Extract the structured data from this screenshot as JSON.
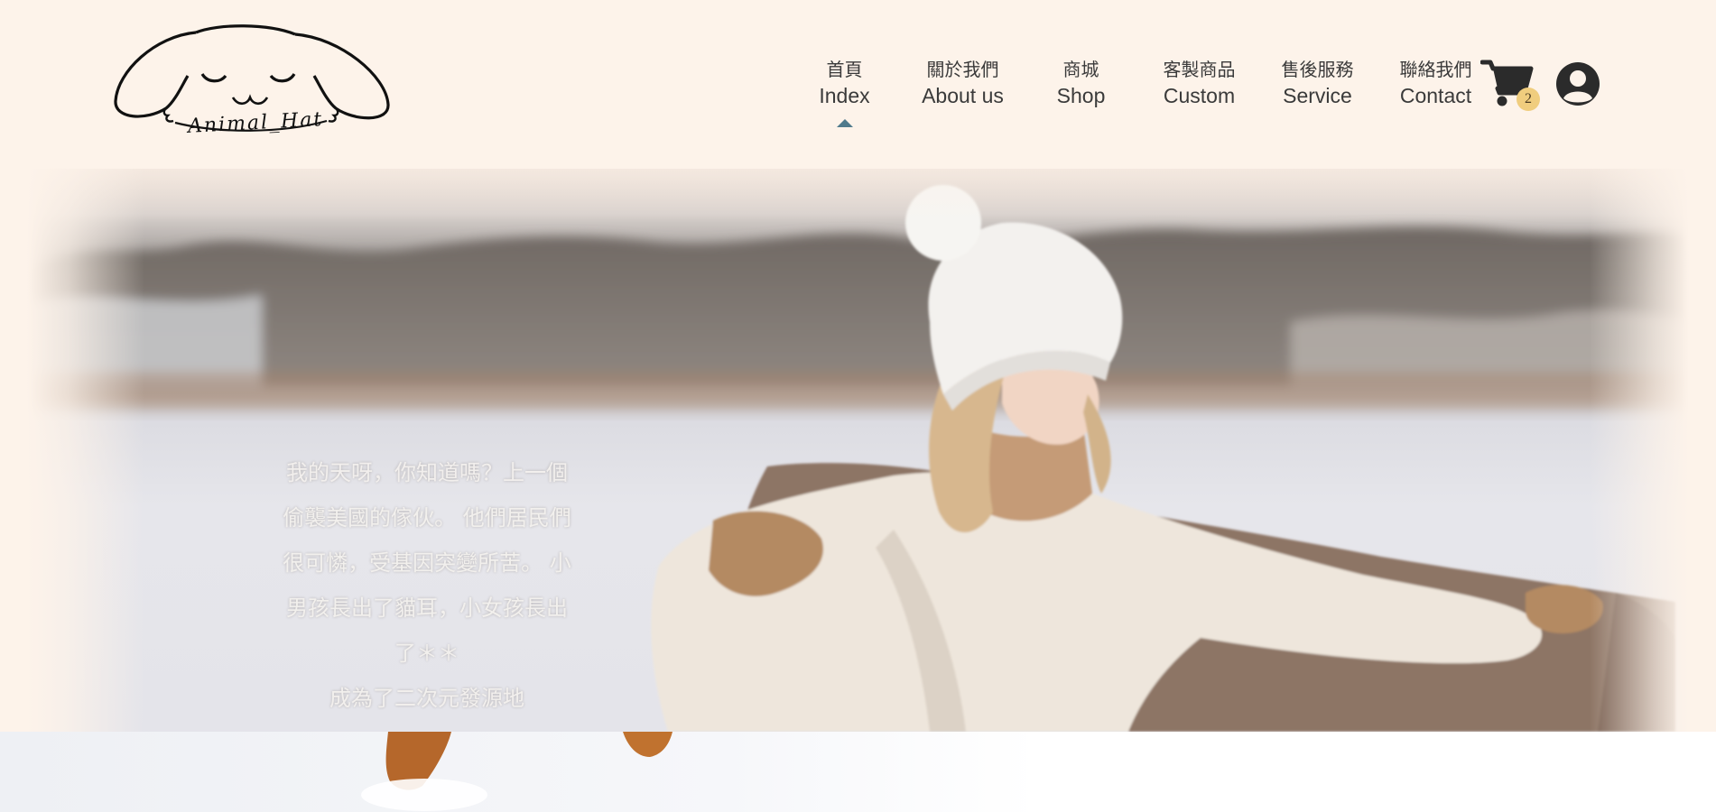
{
  "brand": {
    "logo_text": "Animal_Hat"
  },
  "nav": {
    "items": [
      {
        "zh": "首頁",
        "en": "Index",
        "active": true
      },
      {
        "zh": "關於我們",
        "en": "About us",
        "active": false
      },
      {
        "zh": "商城",
        "en": "Shop",
        "active": false
      },
      {
        "zh": "客製商品",
        "en": "Custom",
        "active": false
      },
      {
        "zh": "售後服務",
        "en": "Service",
        "active": false
      },
      {
        "zh": "聯絡我們",
        "en": "Contact",
        "active": false
      }
    ]
  },
  "cart": {
    "icon": "shopping-cart-icon",
    "count": "2"
  },
  "user": {
    "icon": "user-circle-icon"
  },
  "hero": {
    "lines": [
      "我的天呀，你知道嗎？上一個",
      "偷襲美國的傢伙。 他們居民們",
      "很可憐，受基因突變所苦。 小",
      "男孩長出了貓耳，小女孩長出",
      "了＊＊",
      "成為了二次元發源地"
    ]
  },
  "colors": {
    "header_bg": "#fdf3ea",
    "nav_text": "#3a3a3a",
    "active_caret": "#4f7a8c",
    "badge": "#f0cd7e",
    "icon_dark": "#2b2b2b"
  }
}
